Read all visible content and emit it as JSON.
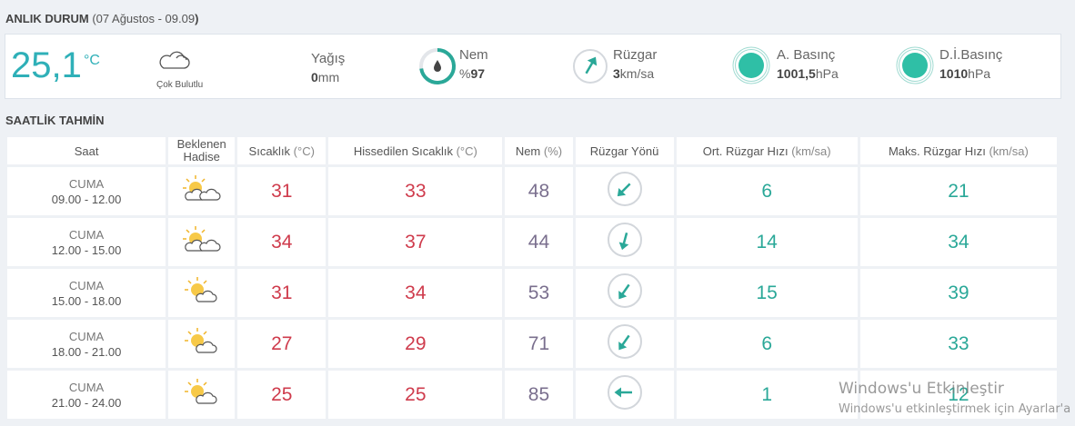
{
  "current": {
    "title_bold": "ANLIK DURUM",
    "title_open": " (",
    "title_date": "07 Ağustos - 09.09",
    "title_close": ")",
    "temp": "25,1",
    "temp_unit": "°C",
    "condition": "Çok Bulutlu",
    "precip_label": "Yağış",
    "precip_value": "0",
    "precip_unit": "mm",
    "humidity_label": "Nem",
    "humidity_prefix": "%",
    "humidity_value": "97",
    "wind_label": "Rüzgar",
    "wind_value": "3",
    "wind_unit": "km/sa",
    "pressure_label": "A. Basınç",
    "pressure_value": "1001,5",
    "pressure_unit": "hPa",
    "sea_pressure_label": "D.İ.Basınç",
    "sea_pressure_value": "1010",
    "sea_pressure_unit": "hPa"
  },
  "hourly": {
    "title": "SAATLİK TAHMİN",
    "headers": {
      "time": "Saat",
      "phenomenon_line1": "Beklenen",
      "phenomenon_line2": "Hadise",
      "temp": "Sıcaklık",
      "temp_unit": " (°C)",
      "feels": "Hissedilen Sıcaklık",
      "feels_unit": " (°C)",
      "humidity": "Nem",
      "humidity_unit": " (%)",
      "wind_dir": "Rüzgar Yönü",
      "avg_wind": "Ort. Rüzgar Hızı",
      "avg_wind_unit": " (km/sa)",
      "max_wind": "Maks. Rüzgar Hızı",
      "max_wind_unit": " (km/sa)"
    },
    "rows": [
      {
        "day": "CUMA",
        "range": "09.00 - 12.00",
        "icon": "partly-cloudy-icon",
        "temp": "31",
        "feels": "33",
        "humidity": "48",
        "wind_dir_deg": 225,
        "avg": "6",
        "max": "21"
      },
      {
        "day": "CUMA",
        "range": "12.00 - 15.00",
        "icon": "partly-cloudy-icon",
        "temp": "34",
        "feels": "37",
        "humidity": "44",
        "wind_dir_deg": 195,
        "avg": "14",
        "max": "34"
      },
      {
        "day": "CUMA",
        "range": "15.00 - 18.00",
        "icon": "sun-cloud-icon",
        "temp": "31",
        "feels": "34",
        "humidity": "53",
        "wind_dir_deg": 215,
        "avg": "15",
        "max": "39"
      },
      {
        "day": "CUMA",
        "range": "18.00 - 21.00",
        "icon": "sun-cloud-icon",
        "temp": "27",
        "feels": "29",
        "humidity": "71",
        "wind_dir_deg": 215,
        "avg": "6",
        "max": "33"
      },
      {
        "day": "CUMA",
        "range": "21.00 - 24.00",
        "icon": "sun-cloud-icon",
        "temp": "25",
        "feels": "25",
        "humidity": "85",
        "wind_dir_deg": 270,
        "avg": "1",
        "max": "12"
      }
    ]
  },
  "current_wind_dir_deg": 30,
  "watermark": {
    "line1": "Windows'u Etkinleştir",
    "line2": "Windows'u etkinleştirmek için Ayarlar'a"
  },
  "colors": {
    "accent": "#2fb0b8",
    "temp": "#cf3b4c",
    "humidity": "#7a6f8e",
    "wind": "#2aa898"
  }
}
